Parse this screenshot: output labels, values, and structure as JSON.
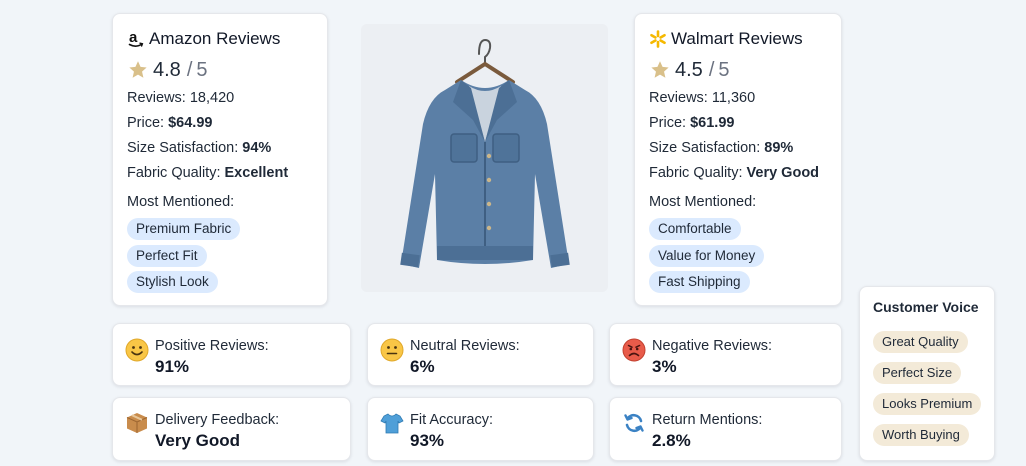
{
  "amazon": {
    "title": "Amazon Reviews",
    "logo_icon": "amazon-logo-icon",
    "rating": "4.8",
    "rating_sep": "/",
    "rating_max": "5",
    "reviews_label": "Reviews:",
    "reviews_value": "18,420",
    "price_label": "Price:",
    "price_value": "$64.99",
    "size_label": "Size Satisfaction:",
    "size_value": "94%",
    "fabric_label": "Fabric Quality:",
    "fabric_value": "Excellent",
    "mentioned_label": "Most Mentioned:",
    "mentioned": [
      "Premium Fabric",
      "Perfect Fit",
      "Stylish Look"
    ]
  },
  "walmart": {
    "title": "Walmart Reviews",
    "logo_icon": "walmart-spark-icon",
    "rating": "4.5",
    "rating_sep": "/",
    "rating_max": "5",
    "reviews_label": "Reviews:",
    "reviews_value": "11,360",
    "price_label": "Price:",
    "price_value": "$61.99",
    "size_label": "Size Satisfaction:",
    "size_value": "89%",
    "fabric_label": "Fabric Quality:",
    "fabric_value": "Very Good",
    "mentioned_label": "Most Mentioned:",
    "mentioned": [
      "Comfortable",
      "Value for Money",
      "Fast Shipping"
    ]
  },
  "metrics": {
    "positive": {
      "label": "Positive Reviews:",
      "value": "91%",
      "icon": "smile-face-icon"
    },
    "neutral": {
      "label": "Neutral Reviews:",
      "value": "6%",
      "icon": "neutral-face-icon"
    },
    "negative": {
      "label": "Negative Reviews:",
      "value": "3%",
      "icon": "angry-face-icon"
    },
    "delivery": {
      "label": "Delivery Feedback:",
      "value": "Very Good",
      "icon": "package-icon"
    },
    "fit": {
      "label": "Fit Accuracy:",
      "value": "93%",
      "icon": "tshirt-icon"
    },
    "returns": {
      "label": "Return Mentions:",
      "value": "2.8%",
      "icon": "refresh-icon"
    }
  },
  "voice": {
    "title": "Customer Voice",
    "tags": [
      "Great Quality",
      "Perfect Size",
      "Looks Premium",
      "Worth Buying"
    ]
  },
  "product": {
    "image_icon": "denim-jacket-image"
  },
  "colors": {
    "page_bg": "#f1f5f9",
    "chip_blue": "#dbeafe",
    "chip_tan": "#f3ead8",
    "star": "#d9c08a",
    "walmart_yellow": "#f5b800",
    "denim": "#5b7fa6"
  }
}
